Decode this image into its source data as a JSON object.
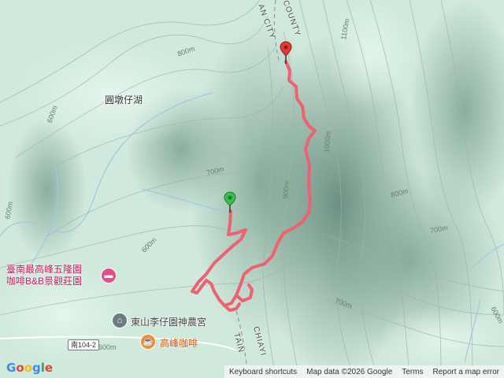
{
  "map": {
    "counties": [
      "COUNTY",
      "AN CITY"
    ],
    "roads_bottom": [
      "TAIN",
      "CHIAYI"
    ],
    "place_label": "圓墩仔湖",
    "pois": {
      "lodging": {
        "line1": "臺南最高峰五隆園",
        "line2": "咖啡B&B景觀莊園"
      },
      "temple": "東山李仔園神農宮",
      "cafe": "高峰咖啡"
    },
    "road_shield": "南104-2",
    "contours": [
      "600m",
      "800m",
      "700m",
      "900m",
      "1000m",
      "1100m",
      "800m",
      "700m",
      "700m",
      "600m",
      "600m",
      "600m",
      "600m",
      "700m",
      "900m",
      "800m",
      "900m"
    ],
    "colors": {
      "route": "#f0616f",
      "start_pin": "#33c24a",
      "end_pin": "#e53935",
      "terrain": "#cfe9dc"
    }
  },
  "attribution": {
    "logo": "Google",
    "shortcuts": "Keyboard shortcuts",
    "data": "Map data ©2026 Google",
    "terms": "Terms",
    "report": "Report a map error"
  }
}
